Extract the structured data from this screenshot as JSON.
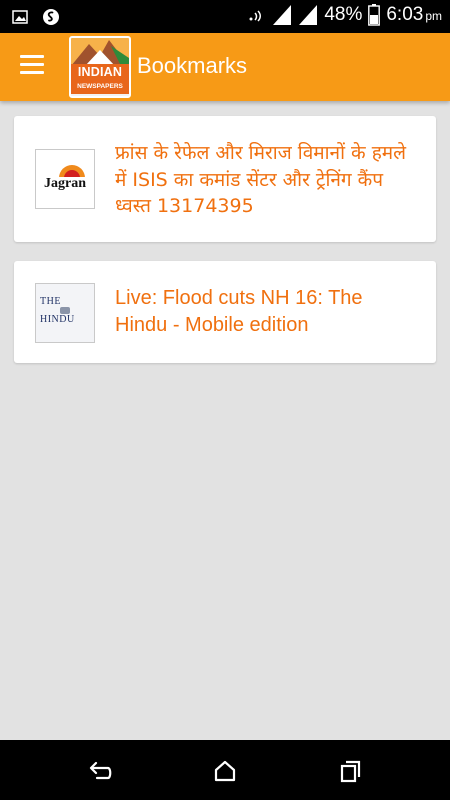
{
  "status_bar": {
    "battery_percent": "48%",
    "time": "6:03",
    "time_suffix": "pm",
    "icons": [
      "image-notification-icon",
      "shazam-icon",
      "vibrate-icon",
      "signal-icon",
      "signal-icon",
      "battery-icon"
    ]
  },
  "app_bar": {
    "logo_word": "INDIAN",
    "logo_subtitle": "NEWSPAPERS",
    "title": "Bookmarks",
    "menu_icon": "hamburger-menu-icon"
  },
  "bookmarks": [
    {
      "source_logo_text": "Jagran",
      "title": "फ्रांस के रेफेल और मिराज विमानों के हमले में ISIS का कमांड सेंटर और ट्रेनिंग कैंप ध्वस्त 13174395"
    },
    {
      "source_logo_text_line1": "THE",
      "source_logo_text_line2": "HINDU",
      "title": "Live: Flood cuts NH 16: The Hindu - Mobile edition"
    }
  ],
  "nav_bar": {
    "icons": [
      "back-icon",
      "home-icon",
      "recents-icon"
    ]
  },
  "colors": {
    "app_bar": "#f79a16",
    "title_text": "#f0700f",
    "background": "#e2e2e2"
  }
}
